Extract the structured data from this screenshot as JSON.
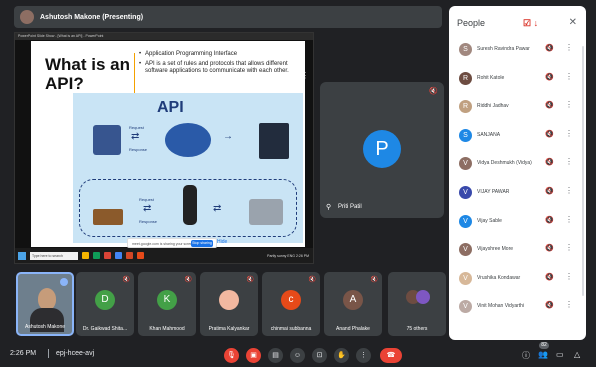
{
  "presenter": {
    "label": "Ashutosh Makone (Presenting)"
  },
  "shared_screen": {
    "window_title": "PowerPoint Slide Show - [What is an API] - PowerPoint",
    "slide": {
      "title": "What is an API?",
      "bullets": [
        "Application Programming Interface",
        "API is a set of rules and protocols that allows different software applications to communicate with each other."
      ],
      "diagram_title": "API",
      "diagram_labels": [
        "Request",
        "Response",
        "Request",
        "Response"
      ]
    },
    "share_notice": "meet.google.com is sharing your screen.",
    "stop_sharing": "Stop sharing",
    "hide": "Hide",
    "taskbar": {
      "search": "Type here to search",
      "tray": "Partly sunny  ENG  2:26 PM"
    }
  },
  "main_participant": {
    "name": "Priti Patil",
    "initial": "P",
    "color": "#1e88e5"
  },
  "people_panel": {
    "title": "People",
    "annotation": "☑ ↓",
    "people": [
      {
        "name": "Suresh Ravindra Pawar",
        "initial": "S",
        "color": "#a1887f"
      },
      {
        "name": "Rohit Katole",
        "initial": "R",
        "color": "#6d4c41"
      },
      {
        "name": "Riddhi Jadhav",
        "initial": "R",
        "color": "#c0a080"
      },
      {
        "name": "SANJANA",
        "initial": "S",
        "color": "#1e88e5"
      },
      {
        "name": "Vidya Deshmukh (Vidya)",
        "initial": "V",
        "color": "#8d6e63"
      },
      {
        "name": "VIJAY PAWAR",
        "initial": "V",
        "color": "#3949ab"
      },
      {
        "name": "Vijay Sable",
        "initial": "V",
        "color": "#1e88e5"
      },
      {
        "name": "Vijayshree More",
        "initial": "V",
        "color": "#8d6e63"
      },
      {
        "name": "Vrushika Kondawar",
        "initial": "V",
        "color": "#d7b899"
      },
      {
        "name": "Vinit Mohan Vidyarthi",
        "initial": "V",
        "color": "#bcaaa4"
      }
    ]
  },
  "bottom_tiles": [
    {
      "name": "Ashutosh Makone",
      "initial": "",
      "color": "",
      "self": true
    },
    {
      "name": "Dr. Gaikwad Shita...",
      "initial": "D",
      "color": "#43a047"
    },
    {
      "name": "Khan Mahmood",
      "initial": "K",
      "color": "#43a047"
    },
    {
      "name": "Pratima Kalyankar",
      "initial": "",
      "color": "#f2b8a0"
    },
    {
      "name": "chinmai subbanna",
      "initial": "c",
      "color": "#e64a19"
    },
    {
      "name": "Anand Phalake",
      "initial": "A",
      "color": "#795548"
    },
    {
      "name": "75 others",
      "initial": "",
      "color": "",
      "others": true
    }
  ],
  "bottom_bar": {
    "time": "2:26 PM",
    "meeting_code": "epj-hcee-avj",
    "participant_count": "82"
  },
  "icons": {
    "mic_off": "🎙̸",
    "more": "⋮",
    "close": "✕",
    "pin": "📌",
    "end_call": "☎"
  }
}
